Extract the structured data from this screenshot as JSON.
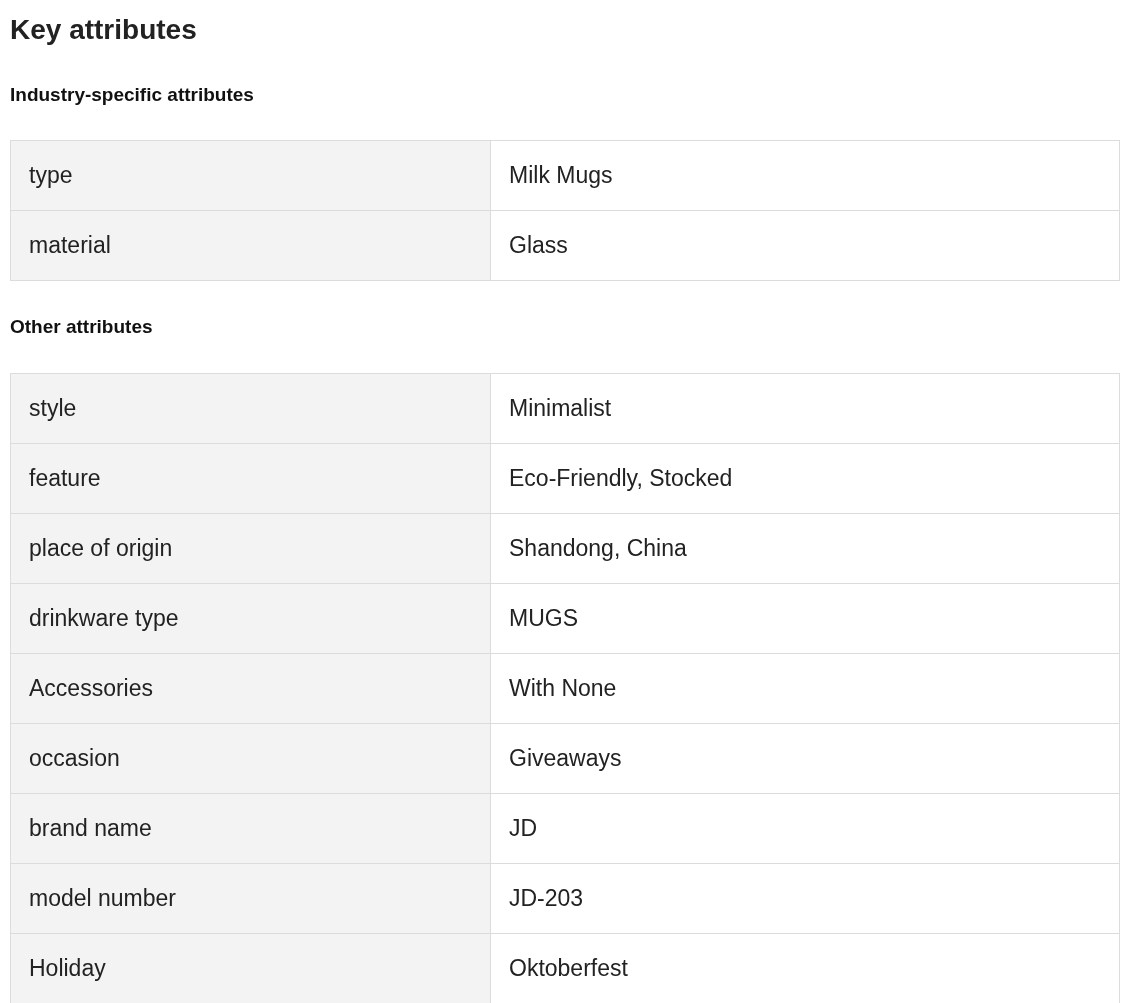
{
  "title": "Key attributes",
  "sections": [
    {
      "heading": "Industry-specific attributes",
      "rows": [
        {
          "key": "type",
          "value": "Milk Mugs"
        },
        {
          "key": "material",
          "value": "Glass"
        }
      ]
    },
    {
      "heading": "Other attributes",
      "rows": [
        {
          "key": "style",
          "value": "Minimalist"
        },
        {
          "key": "feature",
          "value": "Eco-Friendly, Stocked"
        },
        {
          "key": "place of origin",
          "value": "Shandong, China"
        },
        {
          "key": "drinkware type",
          "value": "MUGS"
        },
        {
          "key": "Accessories",
          "value": "With None"
        },
        {
          "key": "occasion",
          "value": "Giveaways"
        },
        {
          "key": "brand name",
          "value": "JD"
        },
        {
          "key": "model number",
          "value": "JD-203"
        },
        {
          "key": "Holiday",
          "value": "Oktoberfest"
        }
      ]
    }
  ]
}
